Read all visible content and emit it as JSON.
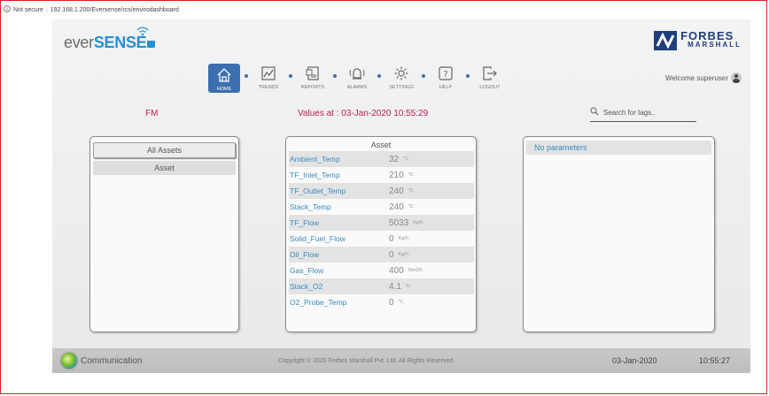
{
  "browser": {
    "security": "Not secure",
    "url": "192.168.1.200/Eversense/rcs/envirodashboard"
  },
  "brand": {
    "product_a": "ever",
    "product_b": "SENSE",
    "company_l1": "FORBES",
    "company_l2": "MARSHALL"
  },
  "nav": [
    {
      "label": "HOME",
      "icon": "home-icon"
    },
    {
      "label": "TRENDS",
      "icon": "trends-icon"
    },
    {
      "label": "REPORTS",
      "icon": "reports-icon"
    },
    {
      "label": "ALARMS",
      "icon": "alarms-icon"
    },
    {
      "label": "SETTINGS",
      "icon": "settings-icon"
    },
    {
      "label": "HELP",
      "icon": "help-icon"
    },
    {
      "label": "LOGOUT",
      "icon": "logout-icon"
    }
  ],
  "welcome": "Welcome superuser",
  "site": "FM",
  "values_at": "Values at : 03-Jan-2020   10:55:29",
  "search": {
    "placeholder": "Search for tags.."
  },
  "assets": {
    "all": "All Assets",
    "item": "Asset"
  },
  "asset_panel": {
    "title": "Asset",
    "rows": [
      {
        "name": "Ambient_Temp",
        "value": "32",
        "unit": "°C"
      },
      {
        "name": "TF_Inlet_Temp",
        "value": "210",
        "unit": "°C"
      },
      {
        "name": "TF_Outlet_Temp",
        "value": "240",
        "unit": "°C"
      },
      {
        "name": "Stack_Temp",
        "value": "240",
        "unit": "°C"
      },
      {
        "name": "TF_Flow",
        "value": "5033",
        "unit": "Kg/h"
      },
      {
        "name": "Solid_Fuel_Flow",
        "value": "0",
        "unit": "Kg/h"
      },
      {
        "name": "Oil_Flow",
        "value": "0",
        "unit": "Kg/h"
      },
      {
        "name": "Gas_Flow",
        "value": "400",
        "unit": "Nm3/h"
      },
      {
        "name": "Stack_O2",
        "value": "4.1",
        "unit": "%"
      },
      {
        "name": "O2_Probe_Temp",
        "value": "0",
        "unit": "°C"
      }
    ]
  },
  "params": "No parameters",
  "footer": {
    "comm": "Communication",
    "copyright": "Copyright © 2020 Forbes Marshall Pvt. Ltd. All Rights Reserved.",
    "date": "03-Jan-2020",
    "time": "10:55:27"
  },
  "colors": {
    "accent": "#3b6fb0",
    "link": "#3a8cc4",
    "magenta": "#c2185b",
    "frame": "#d81e2a"
  }
}
